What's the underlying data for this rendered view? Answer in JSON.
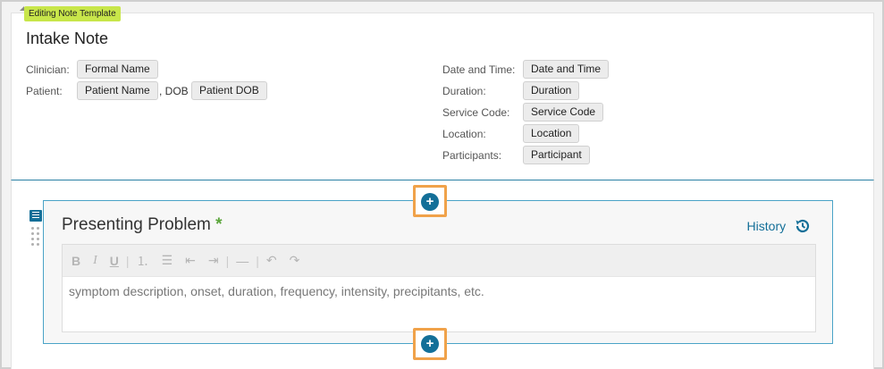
{
  "template_tag": "Editing Note Template",
  "note_title": "Intake Note",
  "header_left": {
    "clinician_label": "Clinician:",
    "clinician_chip": "Formal Name",
    "patient_label": "Patient:",
    "patient_chip": "Patient Name",
    "dob_label": ", DOB",
    "dob_chip": "Patient DOB"
  },
  "header_right": {
    "date_label": "Date and Time:",
    "date_chip": "Date and Time",
    "duration_label": "Duration:",
    "duration_chip": "Duration",
    "service_label": "Service Code:",
    "service_chip": "Service Code",
    "location_label": "Location:",
    "location_chip": "Location",
    "participants_label": "Participants:",
    "participants_chip": "Participant"
  },
  "section": {
    "title": "Presenting Problem",
    "required_marker": "*",
    "history_label": "History",
    "placeholder": "symptom description, onset, duration, frequency, intensity, precipitants, etc."
  },
  "toolbar_icons": [
    "bold-icon",
    "italic-icon",
    "underline-icon",
    "ordered-list-icon",
    "bullet-list-icon",
    "outdent-icon",
    "indent-icon",
    "horizontal-rule-icon",
    "undo-icon",
    "redo-icon"
  ],
  "add_button_glyph": "+",
  "colors": {
    "accent": "#136f98",
    "tag": "#c8e64a",
    "highlight": "#f0a24a",
    "required": "#5aa53a"
  }
}
